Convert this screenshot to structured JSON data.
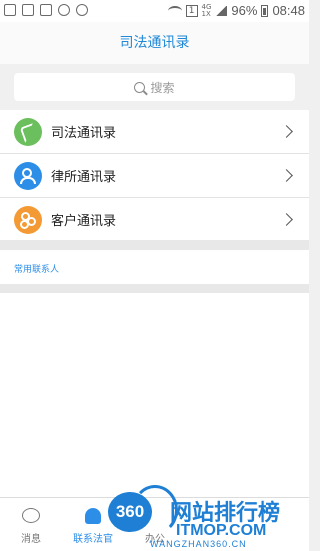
{
  "status_bar": {
    "network_top": "4G",
    "network_bottom": "1X",
    "battery": "96%",
    "time": "08:48"
  },
  "header": {
    "title": "司法通讯录"
  },
  "search": {
    "placeholder": "搜索"
  },
  "directories": [
    {
      "label": "司法通讯录",
      "icon": "phone-icon",
      "color": "#6cbf5d"
    },
    {
      "label": "律所通讯录",
      "icon": "person-icon",
      "color": "#2d8ee8"
    },
    {
      "label": "客户通讯录",
      "icon": "flower-icon",
      "color": "#f39a34"
    }
  ],
  "frequent": {
    "title": "常用联系人"
  },
  "tabs": [
    {
      "label": "消息",
      "icon": "chat-bubble-icon",
      "active": false
    },
    {
      "label": "联系法官",
      "icon": "contact-icon",
      "active": true
    },
    {
      "label": "办公",
      "icon": "office-icon",
      "active": false
    }
  ],
  "watermark": {
    "logo": "360",
    "text": "网站排行榜",
    "domain": "ITMOP.COM",
    "url": "WANGZHAN360.CN"
  },
  "colors": {
    "accent": "#2d8ee8",
    "title": "#1f88d8"
  }
}
